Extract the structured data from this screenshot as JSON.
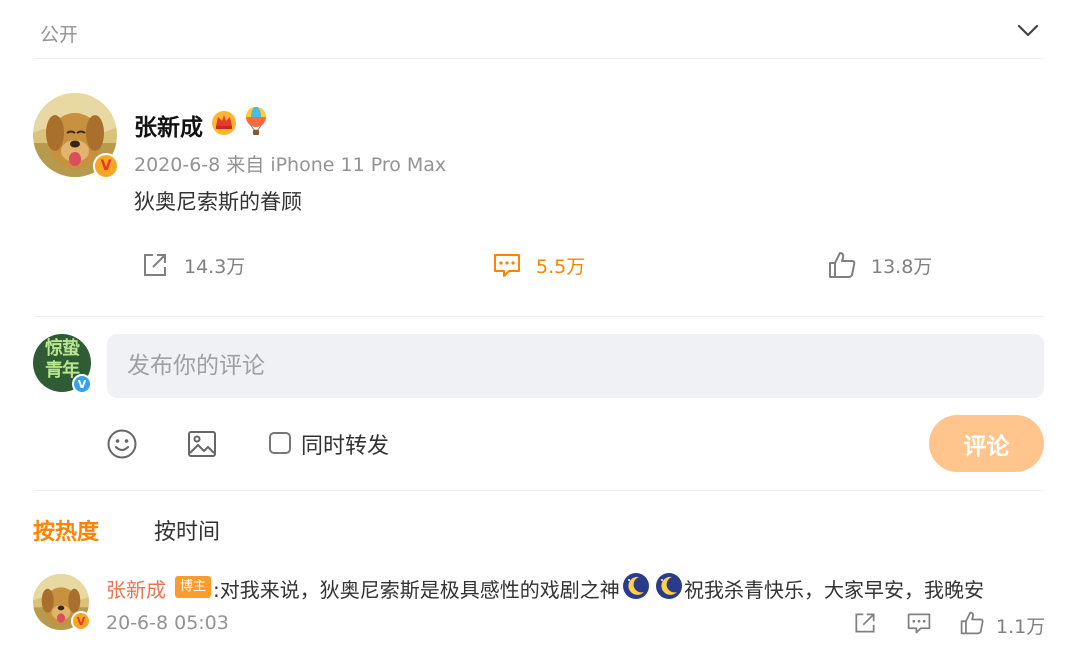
{
  "header": {
    "visibility": "公开"
  },
  "post": {
    "author": "张新成",
    "meta": "2020-6-8 来自 iPhone 11 Pro Max",
    "text": "狄奥尼索斯的眷顾",
    "actions": {
      "repost": "14.3万",
      "comment": "5.5万",
      "like": "13.8万"
    }
  },
  "composer": {
    "placeholder": "发布你的评论",
    "avatar_text": "惊蛰青年",
    "repost_label": "同时转发",
    "submit_label": "评论"
  },
  "sort": {
    "by_hot": "按热度",
    "by_time": "按时间"
  },
  "comments": [
    {
      "author": "张新成",
      "tag": "博主",
      "text_part1": ":对我来说，狄奥尼索斯是极具感性的戏剧之神",
      "text_part2": "祝我杀青快乐，大家早安，我晚安",
      "time": "20-6-8 05:03",
      "likes": "1.1万"
    }
  ],
  "colors": {
    "accent": "#ff8200",
    "author_link": "#eb7350",
    "submit_bg": "#ffc58c"
  }
}
